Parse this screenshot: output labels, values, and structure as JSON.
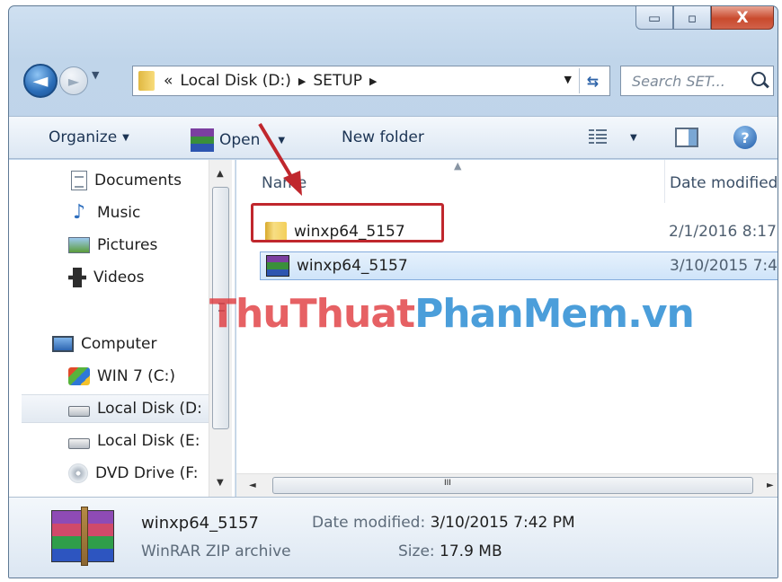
{
  "window": {
    "caption_buttons": {
      "minimize": "▭",
      "maximize": "▫",
      "close": "X"
    }
  },
  "nav": {
    "breadcrumb": [
      "Local Disk (D:)",
      "SETUP"
    ],
    "breadcrumb_overflow": "«",
    "search_placeholder": "Search SET...",
    "refresh_icon": "refresh-icon"
  },
  "toolbar": {
    "organize": "Organize",
    "open": "Open",
    "new_folder": "New folder"
  },
  "sidebar": {
    "items": [
      {
        "label": "Documents",
        "icon": "documents-icon"
      },
      {
        "label": "Music",
        "icon": "music-icon"
      },
      {
        "label": "Pictures",
        "icon": "pictures-icon"
      },
      {
        "label": "Videos",
        "icon": "videos-icon"
      },
      {
        "label": "Computer",
        "icon": "computer-icon"
      },
      {
        "label": "WIN 7 (C:)",
        "icon": "windows-drive-icon"
      },
      {
        "label": "Local Disk (D:",
        "icon": "drive-icon",
        "selected": true
      },
      {
        "label": "Local Disk (E:",
        "icon": "drive-icon"
      },
      {
        "label": "DVD Drive (F:",
        "icon": "dvd-icon"
      }
    ]
  },
  "columns": {
    "name": "Name",
    "date": "Date modified"
  },
  "files": [
    {
      "name": "winxp64_5157",
      "date": "2/1/2016 8:17",
      "type": "folder",
      "highlighted": true
    },
    {
      "name": "winxp64_5157",
      "date": "3/10/2015 7:4",
      "type": "winrar",
      "selected": true
    }
  ],
  "scroll": {
    "h_grip": "III"
  },
  "watermark": {
    "part1": "ThuThuat",
    "part2": "PhanMem.vn"
  },
  "details": {
    "name": "winxp64_5157",
    "type": "WinRAR ZIP archive",
    "date_label": "Date modified:",
    "date_value": "3/10/2015 7:42 PM",
    "size_label": "Size:",
    "size_value": "17.9 MB"
  },
  "colors": {
    "highlight_box": "#c0272d",
    "arrow": "#c0272d",
    "watermark_red": "#e03a3e",
    "watermark_blue": "#1f86d2"
  }
}
